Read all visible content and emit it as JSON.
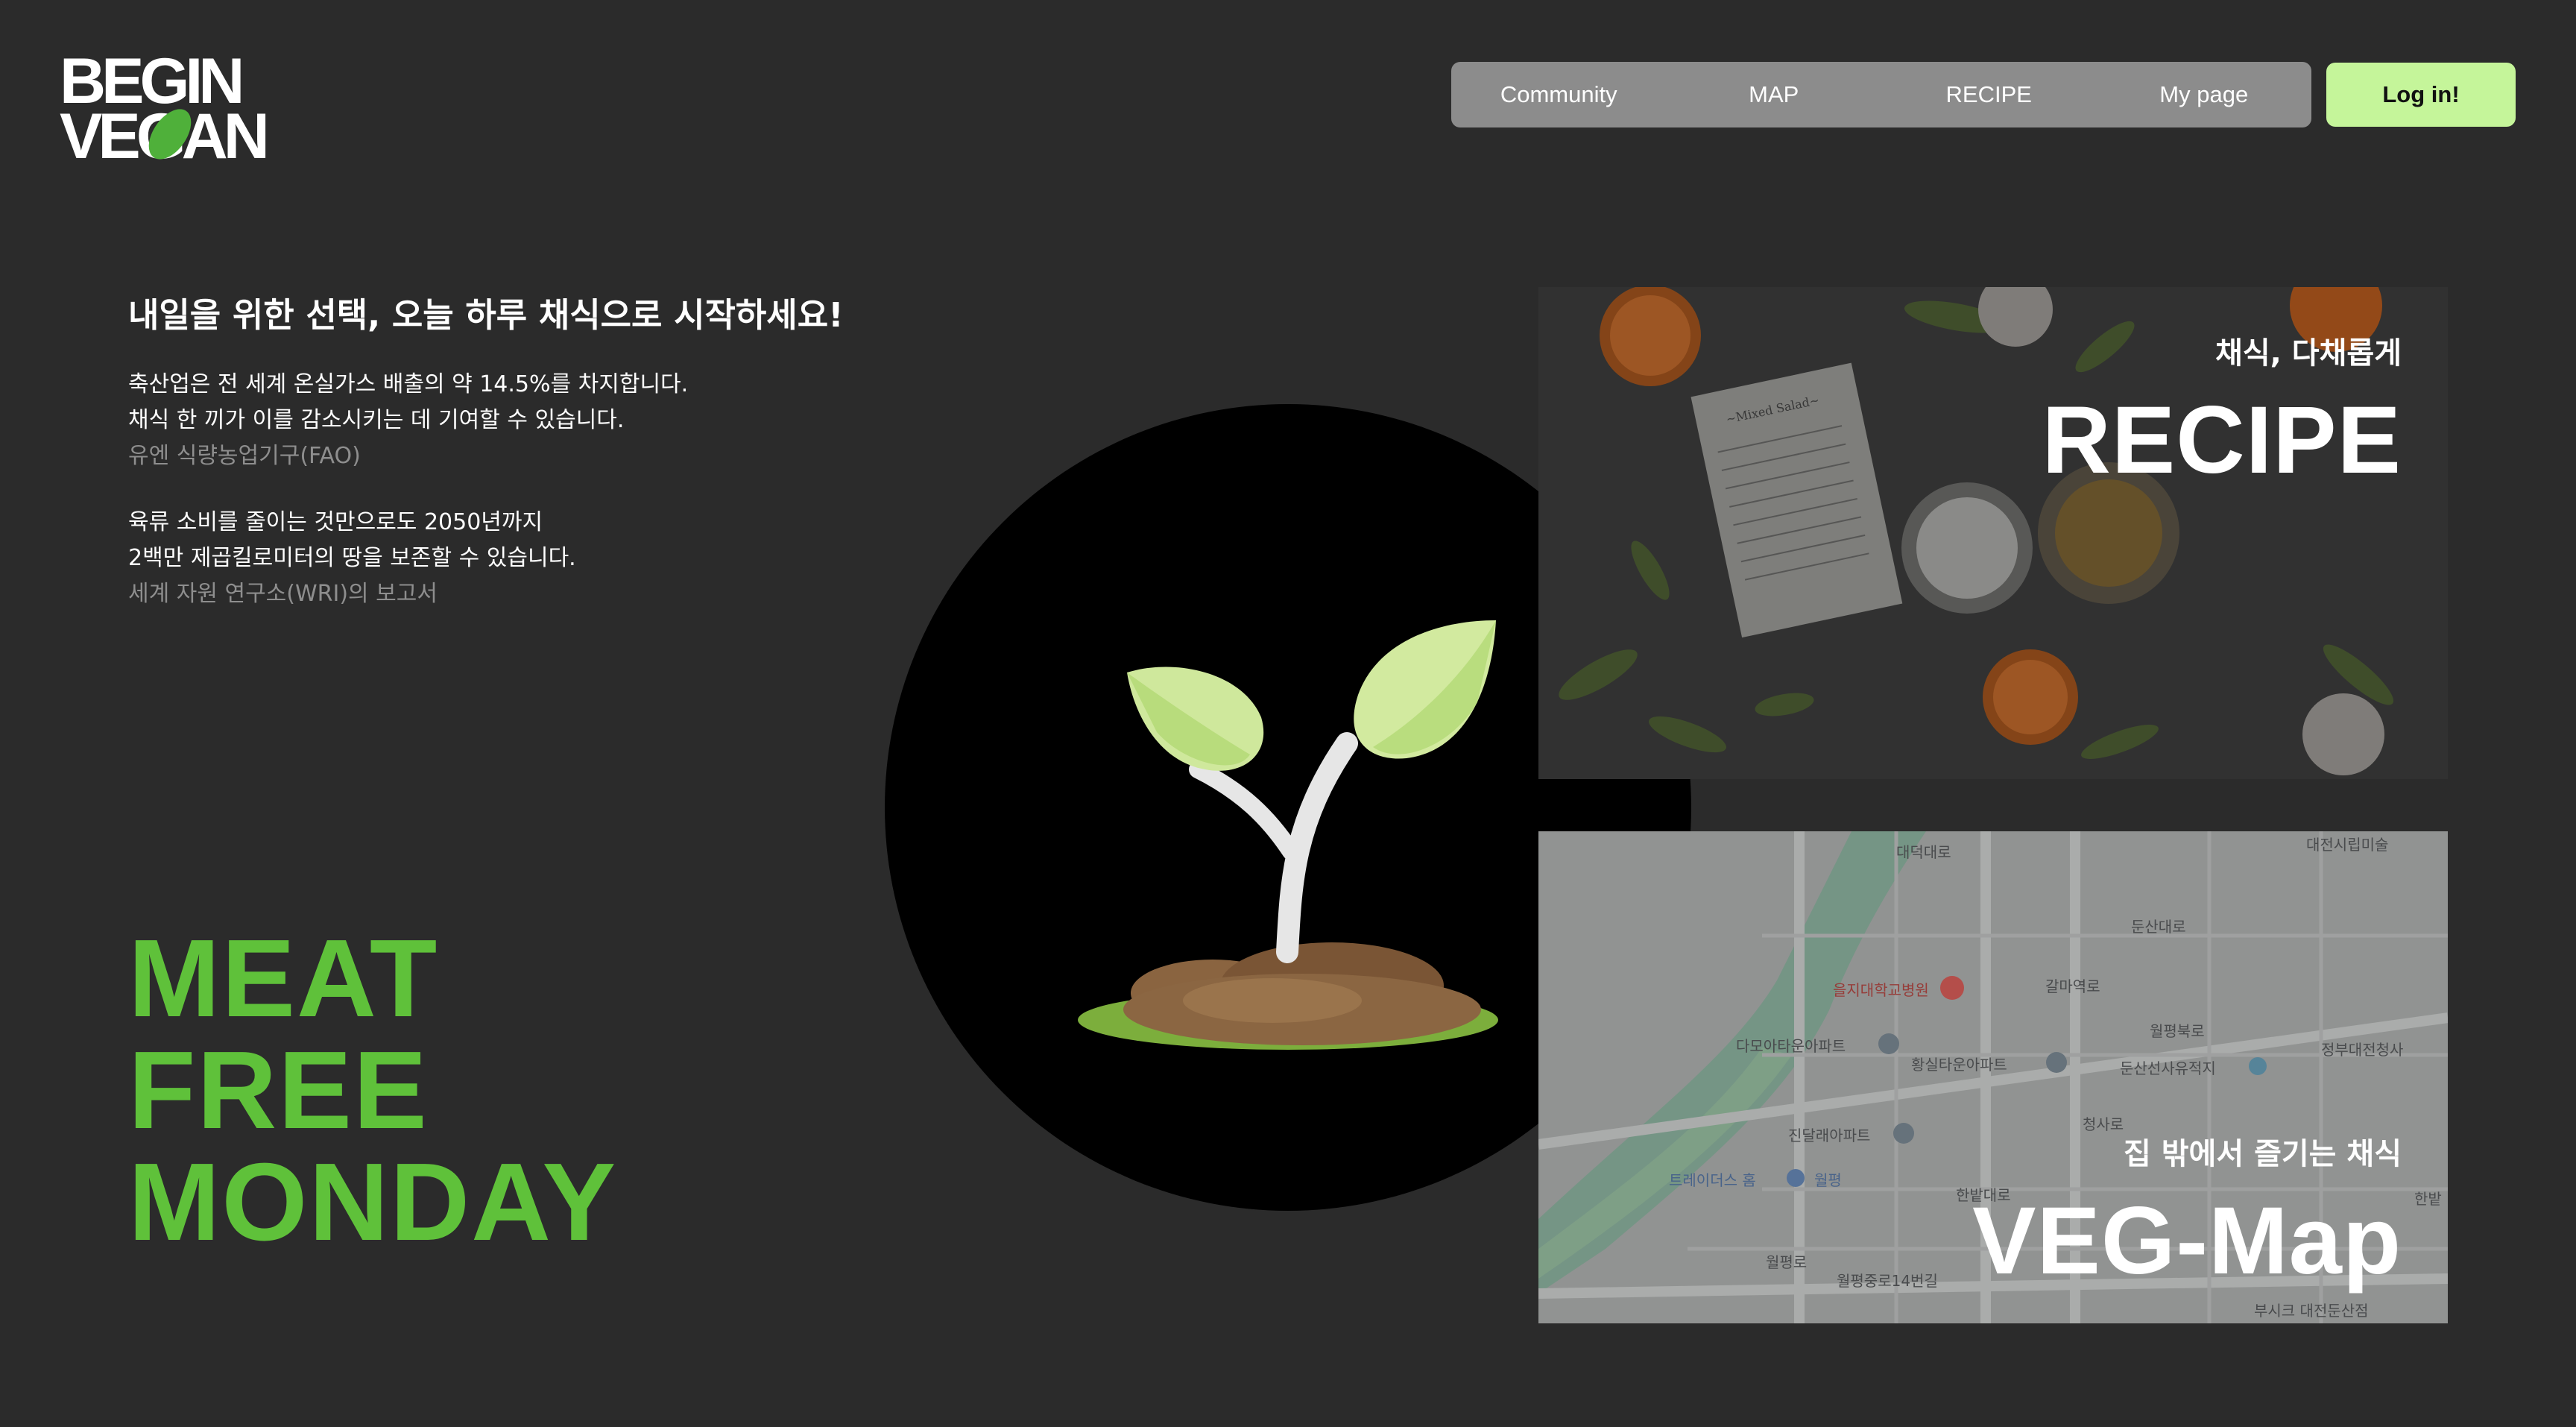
{
  "brand": {
    "logo_line1": "BEGIN",
    "logo_line2": "VEGAN"
  },
  "nav": {
    "items": [
      {
        "label": "Community"
      },
      {
        "label": "MAP"
      },
      {
        "label": "RECIPE"
      },
      {
        "label": "My page"
      }
    ],
    "login_label": "Log in!"
  },
  "hero": {
    "headline": "내일을 위한 선택, 오늘 하루 채식으로 시작하세요!",
    "stats": [
      {
        "lines": [
          "축산업은 전 세계 온실가스 배출의 약 14.5%를 차지합니다.",
          "채식 한 끼가 이를 감소시키는 데 기여할 수 있습니다."
        ],
        "source": "유엔 식량농업기구(FAO)"
      },
      {
        "lines": [
          "육류 소비를 줄이는 것만으로도 2050년까지",
          "2백만 제곱킬로미터의 땅을 보존할 수 있습니다."
        ],
        "source": "세계 자원 연구소(WRI)의 보고서"
      }
    ],
    "slogan": [
      "MEAT",
      "FREE",
      "MONDAY"
    ]
  },
  "cards": {
    "recipe": {
      "subtitle": "채식, 다채롭게",
      "title": "RECIPE",
      "notebook_heading": "~Mixed Salad~"
    },
    "map": {
      "subtitle": "집 밖에서 즐기는 채식",
      "title": "VEG-Map",
      "map_labels": [
        "대전시립미술",
        "둔산대로",
        "을지대학교병원",
        "갈마역로",
        "월평북로",
        "정부대전청사",
        "다모아타운아파트",
        "황실타운아파트",
        "둔산선사유적지",
        "진달래아파트",
        "청사로",
        "트레이더스 홈",
        "월평",
        "한밭대로",
        "월평로",
        "월평중로14번길",
        "부시크 대전둔산점",
        "대덕대로",
        "한밭"
      ]
    }
  },
  "colors": {
    "background": "#2b2b2b",
    "accent_green": "#5fc13a",
    "login_bg": "#c5f59a",
    "nav_bg": "#8c8c8c"
  },
  "icons": [
    "logo-leaf-icon",
    "sprout-illustration",
    "map-pin-icon"
  ]
}
